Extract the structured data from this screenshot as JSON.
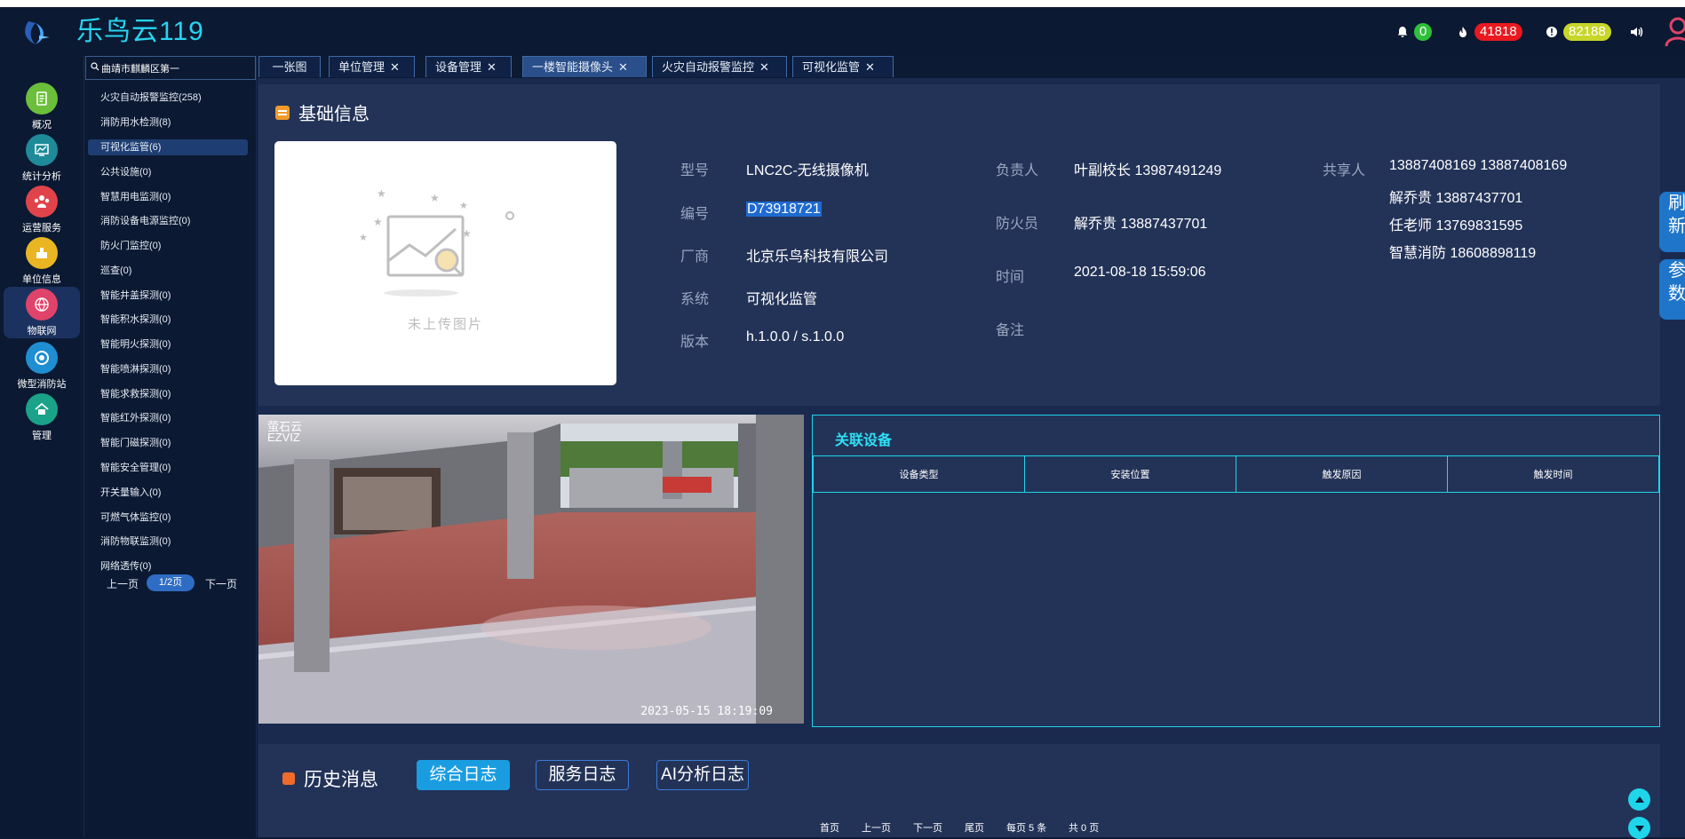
{
  "header": {
    "title": "乐鸟云119",
    "bell_count": "0",
    "fire_count": "41818",
    "warning_count": "82188",
    "colors": {
      "bell": "#2fbf3a",
      "fire": "#e8191f",
      "warning": "#c7d629"
    }
  },
  "rail": {
    "items": [
      {
        "label": "概况",
        "icon": "overview-icon",
        "color": "#6bbf3a"
      },
      {
        "label": "统计分析",
        "icon": "chart-icon",
        "color": "#1e8a9a"
      },
      {
        "label": "运营服务",
        "icon": "people-icon",
        "color": "#e0444a"
      },
      {
        "label": "单位信息",
        "icon": "building-icon",
        "color": "#e9b522"
      },
      {
        "label": "物联网",
        "icon": "iot-icon",
        "color": "#e0436a"
      },
      {
        "label": "微型消防站",
        "icon": "station-icon",
        "color": "#1f8fd1"
      },
      {
        "label": "管理",
        "icon": "home-icon",
        "color": "#1aa388"
      }
    ]
  },
  "tree": {
    "search_value": "曲靖市麒麟区第一",
    "items": [
      "火灾自动报警监控(258)",
      "消防用水检测(8)",
      "可视化监管(6)",
      "公共设施(0)",
      "智慧用电监测(0)",
      "消防设备电源监控(0)",
      "防火门监控(0)",
      "巡查(0)",
      "智能井盖探测(0)",
      "智能积水探测(0)",
      "智能明火探测(0)",
      "智能喷淋探测(0)",
      "智能求救探测(0)",
      "智能红外探测(0)",
      "智能门磁探测(0)",
      "智能安全管理(0)",
      "开关量输入(0)",
      "可燃气体监控(0)",
      "消防物联监测(0)",
      "网络透传(0)"
    ],
    "prev": "上一页",
    "page": "1/2页",
    "next": "下一页"
  },
  "tabs": [
    {
      "label": "一张图",
      "closable": false
    },
    {
      "label": "单位管理",
      "closable": true
    },
    {
      "label": "设备管理",
      "closable": true
    },
    {
      "label": "一楼智能摄像头",
      "closable": true
    },
    {
      "label": "火灾自动报警监控",
      "closable": true
    },
    {
      "label": "可视化监管",
      "closable": true
    }
  ],
  "basic_info": {
    "title": "基础信息",
    "no_image_text": "未上传图片",
    "fields": {
      "model_label": "型号",
      "model": "LNC2C-无线摄像机",
      "serial_label": "编号",
      "serial": "D73918721",
      "vendor_label": "厂商",
      "vendor": "北京乐鸟科技有限公司",
      "system_label": "系统",
      "system": "可视化监管",
      "version_label": "版本",
      "version": "h.1.0.0 / s.1.0.0",
      "owner_label": "负责人",
      "owner": "叶副校长 13987491249",
      "fireman_label": "防火员",
      "fireman": "解乔贵 13887437701",
      "time_label": "时间",
      "time": "2021-08-18 15:59:06",
      "remark_label": "备注",
      "share_label": "共享人",
      "share": [
        "13887408169 13887408169",
        "解乔贵 13887437701",
        "任老师 13769831595",
        "智慧消防 18608898119"
      ]
    }
  },
  "camera": {
    "logo_line1": "萤石云",
    "logo_line2": "EZVIZ",
    "timestamp": "2023-05-15 18:19:09"
  },
  "related": {
    "title": "关联设备",
    "columns": [
      "设备类型",
      "安装位置",
      "触发原因",
      "触发时间"
    ]
  },
  "side_tabs": [
    {
      "line1": "刷",
      "line2": "新"
    },
    {
      "line1": "参",
      "line2": "数"
    }
  ],
  "history": {
    "title": "历史消息",
    "buttons": [
      "综合日志",
      "服务日志",
      "AI分析日志"
    ],
    "pager": {
      "first": "首页",
      "prev": "上一页",
      "next": "下一页",
      "last": "尾页",
      "per_page": "每页 5 条",
      "total": "共 0 页"
    }
  }
}
